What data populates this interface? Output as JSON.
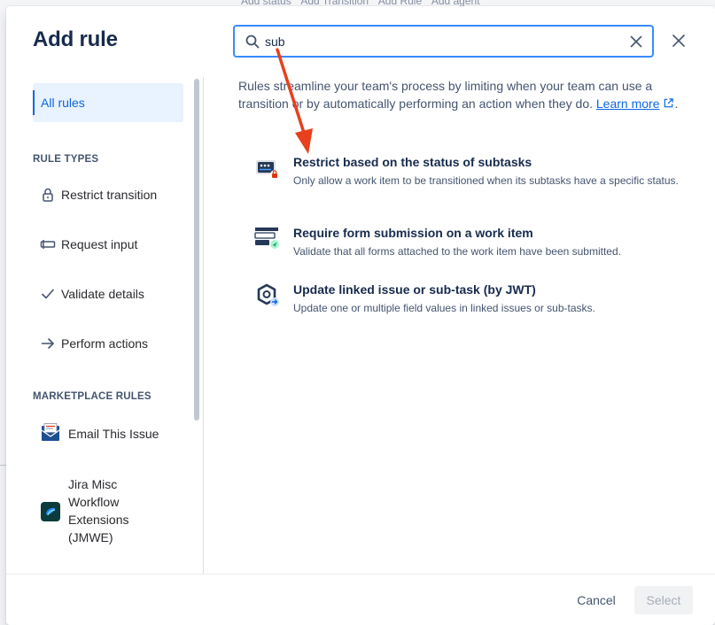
{
  "background": {
    "links": [
      "Add status",
      "Add Transition",
      "Add Rule",
      "Add agent"
    ]
  },
  "modal": {
    "title": "Add rule",
    "close_icon": "close-icon"
  },
  "search": {
    "value": "sub",
    "icon": "search-icon",
    "clear_icon": "clear-icon"
  },
  "sidebar": {
    "all_rules": "All rules",
    "rule_types_heading": "RULE TYPES",
    "rule_types": [
      {
        "label": "Restrict transition",
        "icon": "lock-icon"
      },
      {
        "label": "Request input",
        "icon": "input-field-icon"
      },
      {
        "label": "Validate details",
        "icon": "check-icon"
      },
      {
        "label": "Perform actions",
        "icon": "arrow-right-icon"
      }
    ],
    "marketplace_heading": "MARKETPLACE RULES",
    "marketplace": [
      {
        "label": "Email This Issue",
        "icon": "email-app-icon"
      },
      {
        "label": "Jira Misc Workflow Extensions (JMWE)",
        "icon": "jmwe-app-icon"
      }
    ]
  },
  "main": {
    "intro_text": "Rules streamline your team's process by limiting when your team can use a transition or by automatically performing an action when they do.",
    "learn_more": "Learn more",
    "rules": [
      {
        "name": "Restrict based on the status of subtasks",
        "description": "Only allow a work item to be transitioned when its subtasks have a specific status.",
        "icon": "subtask-status-lock-icon"
      },
      {
        "name": "Require form submission on a work item",
        "description": "Validate that all forms attached to the work item have been submitted.",
        "icon": "form-submission-icon"
      },
      {
        "name": "Update linked issue or sub-task (by JWT)",
        "description": "Update one or multiple field values in linked issues or sub-tasks.",
        "icon": "jwt-update-icon"
      }
    ]
  },
  "footer": {
    "cancel": "Cancel",
    "select": "Select"
  },
  "colors": {
    "accent": "#0c66e4",
    "annotation_arrow": "#e8401c"
  }
}
